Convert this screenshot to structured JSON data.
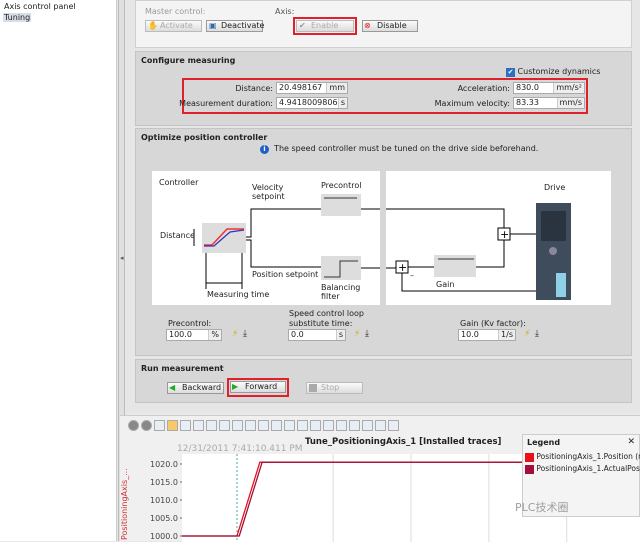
{
  "tree": {
    "items": [
      {
        "label": "Axis control panel",
        "selected": false
      },
      {
        "label": "Tuning",
        "selected": true
      }
    ]
  },
  "master_control": {
    "label": "Master control:",
    "activate": "Activate",
    "deactivate": "Deactivate"
  },
  "axis": {
    "label": "Axis:",
    "enable": "Enable",
    "disable": "Disable"
  },
  "configure": {
    "title": "Configure measuring",
    "customize_dynamics": "Customize dynamics",
    "customize_checked": true,
    "distance_label": "Distance:",
    "distance_value": "20.498167",
    "distance_unit": "mm",
    "duration_label": "Measurement duration:",
    "duration_value": "4.941800980633:",
    "duration_unit": "s",
    "accel_label": "Acceleration:",
    "accel_value": "830.0",
    "accel_unit": "mm/s²",
    "maxvel_label": "Maximum velocity:",
    "maxvel_value": "83.33",
    "maxvel_unit": "mm/s"
  },
  "optimize": {
    "title": "Optimize position controller",
    "info": "The speed controller must be tuned on the drive side beforehand.",
    "diagram": {
      "controller": "Controller",
      "velocity_setpoint_1": "Velocity",
      "velocity_setpoint_2": "setpoint",
      "precontrol": "Precontrol",
      "distance": "Distance",
      "position_setpoint": "Position setpoint",
      "balancing_filter": "Balancing filter",
      "measuring_time": "Measuring time",
      "drive": "Drive",
      "gain": "Gain",
      "minus": "–"
    },
    "precontrol_label": "Precontrol:",
    "precontrol_value": "100.0",
    "precontrol_unit": "%",
    "speed_label_1": "Speed control loop",
    "speed_label_2": "substitute time:",
    "speed_value": "0.0",
    "speed_unit": "s",
    "gain_label": "Gain (Kv factor):",
    "gain_value": "10.0",
    "gain_unit": "1/s"
  },
  "run": {
    "title": "Run measurement",
    "backward": "Backward",
    "forward": "Forward",
    "stop": "Stop"
  },
  "trace": {
    "title": "Tune_PositioningAxis_1 [Installed traces]",
    "timestamp": "12/31/2011 7:41:10.411 PM",
    "y_axis_label": "PositioningAxis_...",
    "legend": {
      "title": "Legend",
      "close": "✕",
      "entries": [
        {
          "label": "PositioningAxis_1.Position (r",
          "color": "#e8101a"
        },
        {
          "label": "PositioningAxis_1.ActualPos",
          "color": "#a0103a"
        }
      ]
    },
    "watermark": "PLC技术圈"
  },
  "chart_data": {
    "type": "line",
    "y_ticks": [
      "1020.0",
      "1015.0",
      "1010.0",
      "1005.0",
      "1000.0"
    ],
    "ylim": [
      1000,
      1020
    ],
    "series": [
      {
        "name": "PositioningAxis_1.Position (r",
        "color": "#e8101a",
        "x": [
          0,
          0.12,
          0.17,
          1
        ],
        "y": [
          1000,
          1000,
          1020.5,
          1020.5
        ]
      },
      {
        "name": "PositioningAxis_1.ActualPos",
        "color": "#a0103a",
        "x": [
          0,
          0.125,
          0.175,
          1
        ],
        "y": [
          1000,
          1000,
          1020.5,
          1020.5
        ]
      }
    ]
  }
}
